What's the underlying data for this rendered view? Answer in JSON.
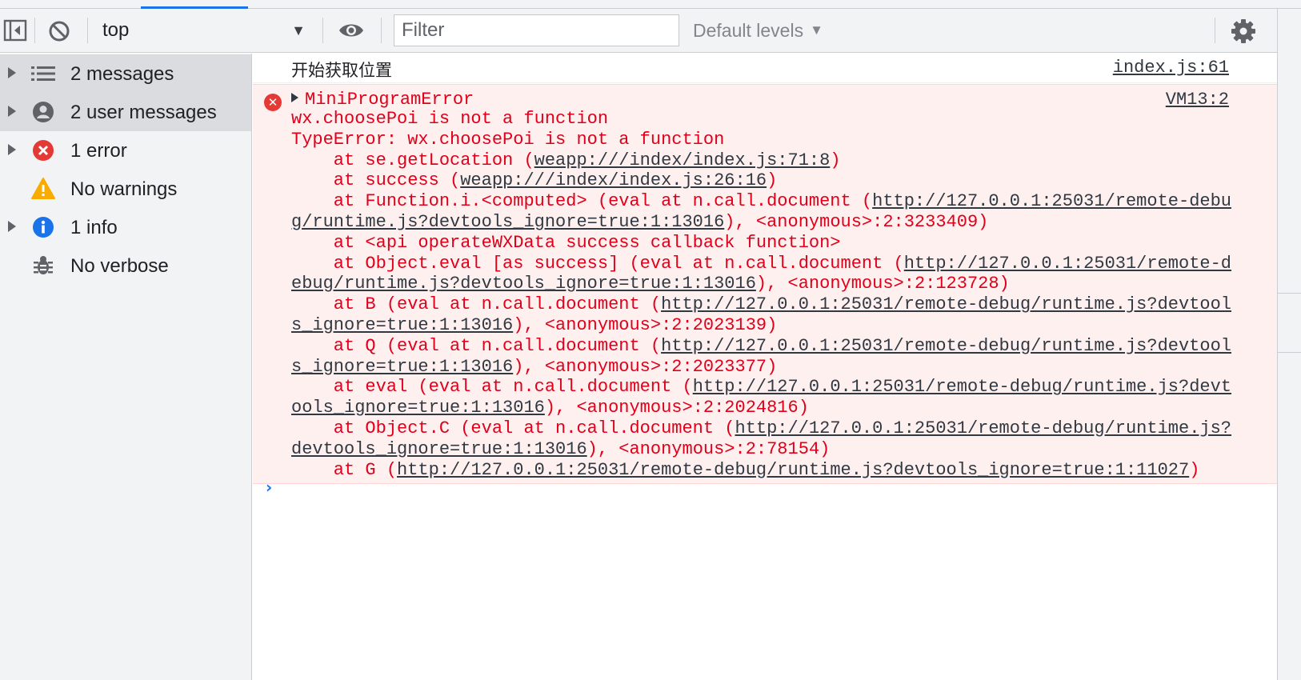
{
  "toolbar": {
    "context": "top",
    "filter_placeholder": "Filter",
    "levels_label": "Default levels",
    "icons": [
      "sidebar-toggle-icon",
      "clear-console-icon",
      "eye-icon",
      "gear-icon"
    ]
  },
  "sidebar": {
    "items": [
      {
        "label": "2 messages",
        "icon": "list-icon",
        "expandable": true,
        "selected": true
      },
      {
        "label": "2 user messages",
        "icon": "user-icon",
        "expandable": true,
        "selected": true
      },
      {
        "label": "1 error",
        "icon": "error-icon",
        "expandable": true,
        "selected": false
      },
      {
        "label": "No warnings",
        "icon": "warning-icon",
        "expandable": false,
        "selected": false
      },
      {
        "label": "1 info",
        "icon": "info-icon",
        "expandable": true,
        "selected": false
      },
      {
        "label": "No verbose",
        "icon": "bug-icon",
        "expandable": false,
        "selected": false
      }
    ]
  },
  "console": {
    "log_message": {
      "text": "开始获取位置",
      "source": "index.js:61"
    },
    "error_message": {
      "title": "MiniProgramError",
      "source": "VM13:2",
      "lines": [
        {
          "pre": "wx.choosePoi is not a function"
        },
        {
          "pre": "TypeError: wx.choosePoi is not a function"
        },
        {
          "pre": "    at se.getLocation (",
          "link": "weapp:///index/index.js:71:8",
          "post": ")"
        },
        {
          "pre": "    at success (",
          "link": "weapp:///index/index.js:26:16",
          "post": ")"
        },
        {
          "pre": "    at Function.i.<computed> (eval at n.call.document (",
          "link": "http://127.0.0.1:25031/remote-debu"
        },
        {
          "link": "g/runtime.js?devtools_ignore=true:1:13016",
          "post": "), <anonymous>:2:3233409)"
        },
        {
          "pre": "    at <api operateWXData success callback function>"
        },
        {
          "pre": "    at Object.eval [as success] (eval at n.call.document (",
          "link": "http://127.0.0.1:25031/remote-d"
        },
        {
          "link": "ebug/runtime.js?devtools_ignore=true:1:13016",
          "post": "), <anonymous>:2:123728)"
        },
        {
          "pre": "    at B (eval at n.call.document (",
          "link": "http://127.0.0.1:25031/remote-debug/runtime.js?devtool"
        },
        {
          "link": "s_ignore=true:1:13016",
          "post": "), <anonymous>:2:2023139)"
        },
        {
          "pre": "    at Q (eval at n.call.document (",
          "link": "http://127.0.0.1:25031/remote-debug/runtime.js?devtool"
        },
        {
          "link": "s_ignore=true:1:13016",
          "post": "), <anonymous>:2:2023377)"
        },
        {
          "pre": "    at eval (eval at n.call.document (",
          "link": "http://127.0.0.1:25031/remote-debug/runtime.js?devt"
        },
        {
          "link": "ools_ignore=true:1:13016",
          "post": "), <anonymous>:2:2024816)"
        },
        {
          "pre": "    at Object.C (eval at n.call.document (",
          "link": "http://127.0.0.1:25031/remote-debug/runtime.js?"
        },
        {
          "link": "devtools_ignore=true:1:13016",
          "post": "), <anonymous>:2:78154)"
        },
        {
          "pre": "    at G (",
          "link": "http://127.0.0.1:25031/remote-debug/runtime.js?devtools_ignore=true:1:11027",
          "post": ")"
        }
      ]
    },
    "prompt_symbol": "›"
  },
  "colors": {
    "error_text": "#e0001a",
    "error_bg": "#fff0f0",
    "link_text": "#303942",
    "accent": "#1a73e8",
    "toolbar_bg": "#f1f3f4",
    "selected_bg": "#dadce0"
  }
}
